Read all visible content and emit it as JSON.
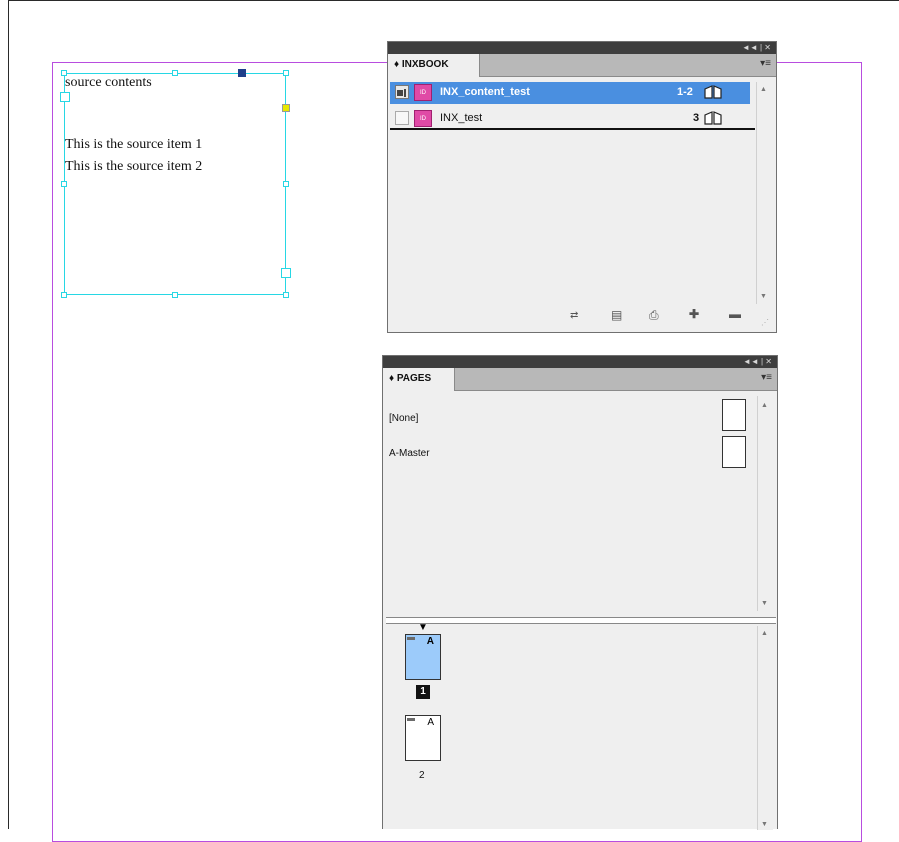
{
  "canvas": {
    "frame_lines": [
      "source contents",
      "",
      "This is the source item 1",
      "This is the source item 2"
    ],
    "guide_color": "#b84ddf",
    "frame_color": "#27d7e4"
  },
  "inxbook_panel": {
    "titlebar_buttons": "◄◄ | ✕",
    "tab_label": "♦ INXBOOK",
    "menu_icon": "▾≡",
    "documents": [
      {
        "name": "INX_content_test",
        "pages": "1-2",
        "selected": true
      },
      {
        "name": "INX_test",
        "pages": "3",
        "selected": false
      }
    ],
    "footer_icons": [
      "synchronize-icon",
      "save-icon",
      "print-icon",
      "add-document-icon",
      "remove-document-icon"
    ]
  },
  "pages_panel": {
    "titlebar_buttons": "◄◄ | ✕",
    "tab_label": "♦ PAGES",
    "menu_icon": "▾≡",
    "masters": [
      "[None]",
      "A-Master"
    ],
    "pages": [
      {
        "number": "1",
        "prefix": "A",
        "active": true
      },
      {
        "number": "2",
        "prefix": "A",
        "active": false
      }
    ]
  }
}
